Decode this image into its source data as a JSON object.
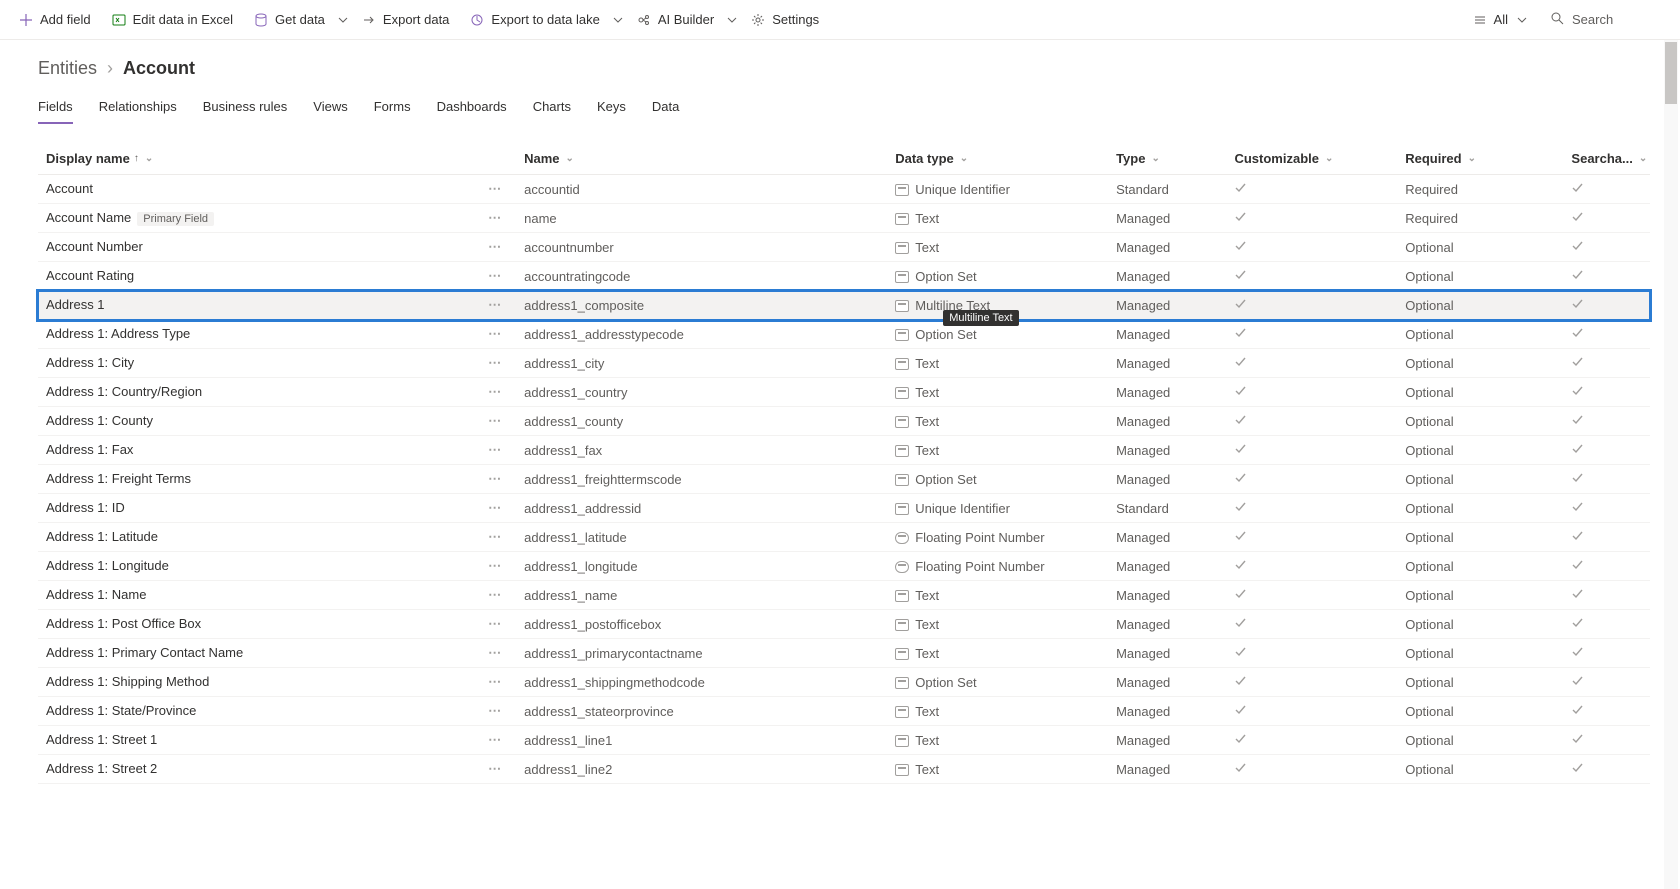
{
  "commandbar": {
    "add_field": "Add field",
    "edit_excel": "Edit data in Excel",
    "get_data": "Get data",
    "export_data": "Export data",
    "export_lake": "Export to data lake",
    "ai_builder": "AI Builder",
    "settings": "Settings",
    "view_filter": "All",
    "search_placeholder": "Search"
  },
  "breadcrumb": {
    "parent": "Entities",
    "current": "Account"
  },
  "tabs": [
    {
      "label": "Fields",
      "active": true
    },
    {
      "label": "Relationships"
    },
    {
      "label": "Business rules"
    },
    {
      "label": "Views"
    },
    {
      "label": "Forms"
    },
    {
      "label": "Dashboards"
    },
    {
      "label": "Charts"
    },
    {
      "label": "Keys"
    },
    {
      "label": "Data"
    }
  ],
  "columns": {
    "display_name": "Display name",
    "name": "Name",
    "data_type": "Data type",
    "type": "Type",
    "customizable": "Customizable",
    "required": "Required",
    "searchable": "Searcha..."
  },
  "tooltip": "Multiline Text",
  "rows": [
    {
      "display": "Account",
      "name": "accountid",
      "dtype": "Unique Identifier",
      "type": "Standard",
      "cust": true,
      "req": "Required",
      "sear": true
    },
    {
      "display": "Account Name",
      "badge": "Primary Field",
      "name": "name",
      "dtype": "Text",
      "type": "Managed",
      "cust": true,
      "req": "Required",
      "sear": true
    },
    {
      "display": "Account Number",
      "name": "accountnumber",
      "dtype": "Text",
      "type": "Managed",
      "cust": true,
      "req": "Optional",
      "sear": true
    },
    {
      "display": "Account Rating",
      "name": "accountratingcode",
      "dtype": "Option Set",
      "type": "Managed",
      "cust": true,
      "req": "Optional",
      "sear": true
    },
    {
      "display": "Address 1",
      "name": "address1_composite",
      "dtype": "Multiline Text",
      "type": "Managed",
      "cust": true,
      "req": "Optional",
      "sear": true,
      "selected": true,
      "tooltip": true
    },
    {
      "display": "Address 1: Address Type",
      "name": "address1_addresstypecode",
      "dtype": "Option Set",
      "type": "Managed",
      "cust": true,
      "req": "Optional",
      "sear": true
    },
    {
      "display": "Address 1: City",
      "name": "address1_city",
      "dtype": "Text",
      "type": "Managed",
      "cust": true,
      "req": "Optional",
      "sear": true
    },
    {
      "display": "Address 1: Country/Region",
      "name": "address1_country",
      "dtype": "Text",
      "type": "Managed",
      "cust": true,
      "req": "Optional",
      "sear": true
    },
    {
      "display": "Address 1: County",
      "name": "address1_county",
      "dtype": "Text",
      "type": "Managed",
      "cust": true,
      "req": "Optional",
      "sear": true
    },
    {
      "display": "Address 1: Fax",
      "name": "address1_fax",
      "dtype": "Text",
      "type": "Managed",
      "cust": true,
      "req": "Optional",
      "sear": true
    },
    {
      "display": "Address 1: Freight Terms",
      "name": "address1_freighttermscode",
      "dtype": "Option Set",
      "type": "Managed",
      "cust": true,
      "req": "Optional",
      "sear": true
    },
    {
      "display": "Address 1: ID",
      "name": "address1_addressid",
      "dtype": "Unique Identifier",
      "type": "Standard",
      "cust": true,
      "req": "Optional",
      "sear": true
    },
    {
      "display": "Address 1: Latitude",
      "name": "address1_latitude",
      "dtype": "Floating Point Number",
      "dtclass": "float",
      "type": "Managed",
      "cust": true,
      "req": "Optional",
      "sear": true
    },
    {
      "display": "Address 1: Longitude",
      "name": "address1_longitude",
      "dtype": "Floating Point Number",
      "dtclass": "float",
      "type": "Managed",
      "cust": true,
      "req": "Optional",
      "sear": true
    },
    {
      "display": "Address 1: Name",
      "name": "address1_name",
      "dtype": "Text",
      "type": "Managed",
      "cust": true,
      "req": "Optional",
      "sear": true
    },
    {
      "display": "Address 1: Post Office Box",
      "name": "address1_postofficebox",
      "dtype": "Text",
      "type": "Managed",
      "cust": true,
      "req": "Optional",
      "sear": true
    },
    {
      "display": "Address 1: Primary Contact Name",
      "name": "address1_primarycontactname",
      "dtype": "Text",
      "type": "Managed",
      "cust": true,
      "req": "Optional",
      "sear": true
    },
    {
      "display": "Address 1: Shipping Method",
      "name": "address1_shippingmethodcode",
      "dtype": "Option Set",
      "type": "Managed",
      "cust": true,
      "req": "Optional",
      "sear": true
    },
    {
      "display": "Address 1: State/Province",
      "name": "address1_stateorprovince",
      "dtype": "Text",
      "type": "Managed",
      "cust": true,
      "req": "Optional",
      "sear": true
    },
    {
      "display": "Address 1: Street 1",
      "name": "address1_line1",
      "dtype": "Text",
      "type": "Managed",
      "cust": true,
      "req": "Optional",
      "sear": true
    },
    {
      "display": "Address 1: Street 2",
      "name": "address1_line2",
      "dtype": "Text",
      "type": "Managed",
      "cust": true,
      "req": "Optional",
      "sear": true
    }
  ]
}
